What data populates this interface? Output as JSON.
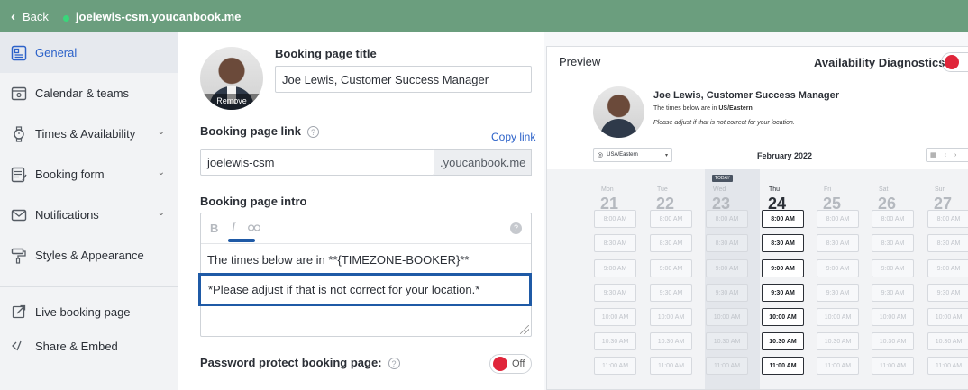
{
  "topbar": {
    "back_label": "Back",
    "site": "joelewis-csm.youcanbook.me"
  },
  "sidebar": {
    "items": [
      {
        "label": "General",
        "icon": "general-icon"
      },
      {
        "label": "Calendar & teams",
        "icon": "calendar-icon"
      },
      {
        "label": "Times & Availability",
        "icon": "watch-icon"
      },
      {
        "label": "Booking form",
        "icon": "form-icon"
      },
      {
        "label": "Notifications",
        "icon": "mail-icon"
      },
      {
        "label": "Styles & Appearance",
        "icon": "paint-roller-icon"
      }
    ],
    "links": [
      {
        "label": "Live booking page",
        "icon": "external-link-icon"
      },
      {
        "label": "Share & Embed",
        "icon": "code-icon"
      }
    ]
  },
  "form": {
    "avatar_remove": "Remove",
    "title_label": "Booking page title",
    "title_value": "Joe Lewis, Customer Success Manager",
    "link_label": "Booking page link",
    "copy_link": "Copy link",
    "link_value": "joelewis-csm",
    "link_suffix": ".youcanbook.me",
    "intro_label": "Booking page intro",
    "toolbar": {
      "bold": "B",
      "italic": "I",
      "help": "?"
    },
    "intro_line1": "The times below are in **{TIMEZONE-BOOKER}**",
    "intro_line2": "*Please adjust if that is not correct for your location.*",
    "password_label": "Password protect booking page:",
    "password_toggle": "Off"
  },
  "preview": {
    "tab_label": "Preview",
    "diagnostics_label": "Availability Diagnostics",
    "title": "Joe Lewis, Customer Success Manager",
    "subtitle_prefix": "The times below are in ",
    "subtitle_tz": "US/Eastern",
    "note": "Please adjust if that is not correct for your location.",
    "timezone": "USA/Eastern",
    "month": "February 2022",
    "today_badge": "TODAY",
    "days": [
      {
        "dow": "Mon",
        "num": "21",
        "available": false
      },
      {
        "dow": "Tue",
        "num": "22",
        "available": false
      },
      {
        "dow": "Wed",
        "num": "23",
        "available": false,
        "today": true
      },
      {
        "dow": "Thu",
        "num": "24",
        "available": true
      },
      {
        "dow": "Fri",
        "num": "25",
        "available": false
      },
      {
        "dow": "Sat",
        "num": "26",
        "available": false
      },
      {
        "dow": "Sun",
        "num": "27",
        "available": false
      }
    ],
    "slots": [
      "8:00 AM",
      "8:30 AM",
      "9:00 AM",
      "9:30 AM",
      "10:00 AM",
      "10:30 AM",
      "11:00 AM"
    ]
  },
  "colors": {
    "topbar": "#6b9e7e",
    "accent": "#2c62c9",
    "highlight": "#1f5aa6",
    "toggle_off": "#e0253a"
  }
}
